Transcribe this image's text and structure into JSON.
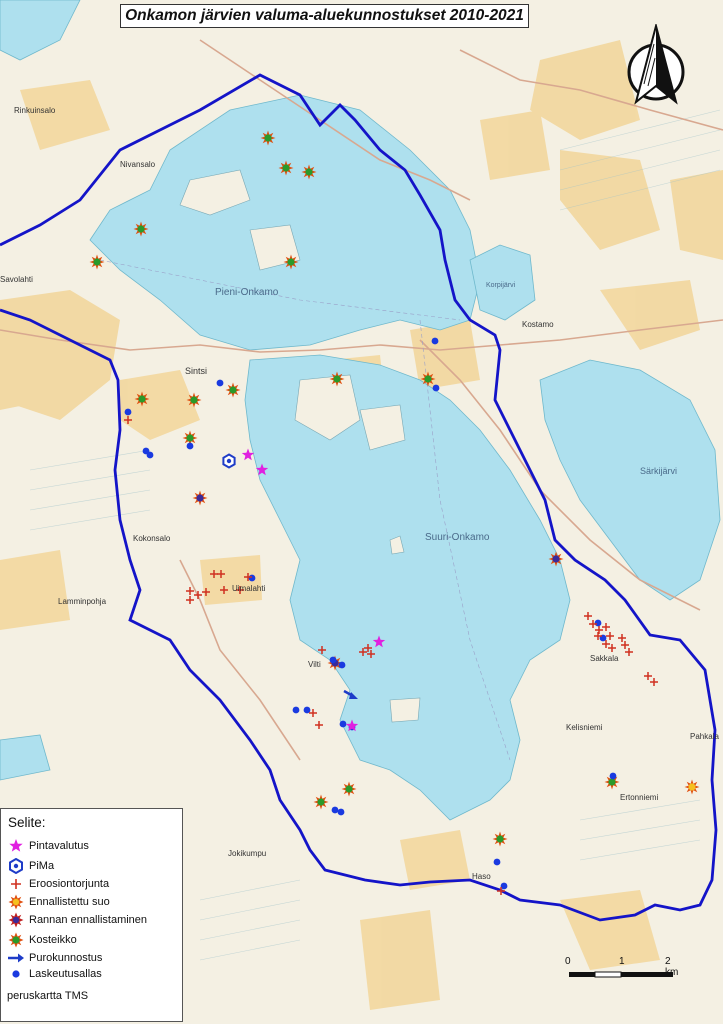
{
  "title": "Onkamon järvien valuma-aluekunnostukset 2010-2021",
  "map_labels": {
    "lake_north": "Pieni-Onkamo",
    "lake_south": "Suuri-Onkamo",
    "lake_east": "Särkijärvi",
    "lake_ne": "Korpijärvi",
    "village_1": "Sintsi",
    "village_2": "Kokonsalo",
    "village_3": "Uimalahti",
    "village_4": "Vilti",
    "village_5": "Haso",
    "village_6": "Kostamo",
    "village_7": "Savolahti",
    "village_8": "Lamminpohja",
    "village_9": "Ertonniemi",
    "village_10": "Pahkala",
    "village_11": "Nivansalo",
    "village_12": "Rinkuinsalo",
    "village_13": "Sakkala",
    "village_14": "Kelisniemi",
    "village_15": "Jokikumpu"
  },
  "legend": {
    "heading": "Selite:",
    "items": [
      {
        "label": "Pintavalutus",
        "icon": "magenta-star-icon",
        "color": "#e020e0"
      },
      {
        "label": "PiMa",
        "icon": "blue-hexagon-icon",
        "color": "#1e3cc8"
      },
      {
        "label": "Eroosiontorjunta",
        "icon": "red-cross-icon",
        "color": "#d03020"
      },
      {
        "label": "Ennallistettu suo",
        "icon": "orange-burst-icon",
        "color": "#f0a020"
      },
      {
        "label": "Rannan ennallistaminen",
        "icon": "purple-burst-icon",
        "color": "#5a2a9a"
      },
      {
        "label": "Kosteikko",
        "icon": "green-burst-icon",
        "color": "#2a9a2a"
      },
      {
        "label": "Purokunnostus",
        "icon": "blue-arrow-icon",
        "color": "#1e3cc8"
      },
      {
        "label": "Laskeutusallas",
        "icon": "blue-dot-icon",
        "color": "#1a3ae0"
      }
    ],
    "note": "peruskartta TMS"
  },
  "scale": {
    "labels": [
      "0",
      "1",
      "2 km"
    ]
  },
  "colors": {
    "water": "#aee0ee",
    "boundary": "#1414c8",
    "land": "#f3efe2",
    "field": "#f2d9a0"
  }
}
